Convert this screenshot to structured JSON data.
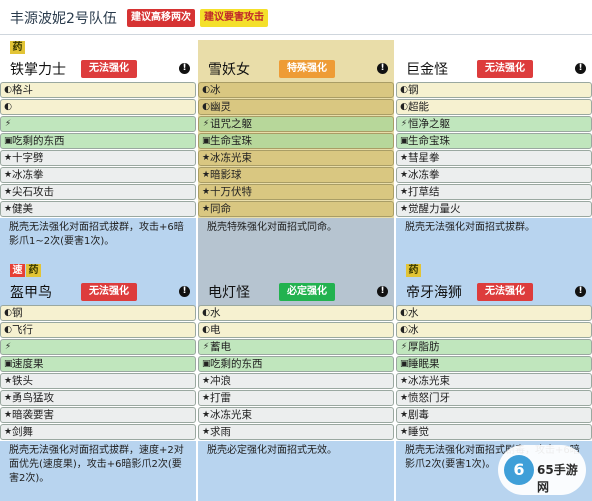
{
  "header": {
    "title": "丰源波妮2号队伍",
    "tag_red": "建议高移两次",
    "tag_yellow": "建议要害攻击"
  },
  "cards": [
    {
      "badges": [
        "药"
      ],
      "name": "铁掌力士",
      "status": "无法强化",
      "ability": "格斗",
      "ability2": "",
      "item": "",
      "held": "吃剩的东西",
      "moves": [
        "十字劈",
        "冰冻拳",
        "尖石攻击",
        "健美"
      ],
      "desc": "脱壳无法强化对面招式拔群，攻击+6暗影爪1~2次(要害1次)。"
    },
    {
      "badges": [],
      "name": "雪妖女",
      "status": "特殊强化",
      "ability": "冰",
      "ability2": "幽灵",
      "item": "诅咒之躯",
      "held": "生命宝珠",
      "moves": [
        "冰冻光束",
        "暗影球",
        "十万伏特",
        "同命"
      ],
      "desc": "脱壳特殊强化对面招式同命。"
    },
    {
      "badges": [],
      "name": "巨金怪",
      "status": "无法强化",
      "ability": "钢",
      "ability2": "超能",
      "item": "恒净之躯",
      "held": "生命宝珠",
      "moves": [
        "彗星拳",
        "冰冻拳",
        "打草结",
        "觉醒力量火"
      ],
      "desc": "脱壳无法强化对面招式拔群。"
    },
    {
      "badges": [
        "速",
        "药"
      ],
      "name": "盔甲鸟",
      "status": "无法强化",
      "ability": "钢",
      "ability2": "飞行",
      "item": "",
      "held": "速度果",
      "moves": [
        "铁头",
        "勇鸟猛攻",
        "暗袭要害",
        "剑舞"
      ],
      "desc": "脱壳无法强化对面招式拔群，速度+2对面优先(速度果)，攻击+6暗影爪2次(要害2次)。"
    },
    {
      "badges": [],
      "name": "电灯怪",
      "status": "必定强化",
      "ability": "水",
      "ability2": "电",
      "item": "蓄电",
      "held": "吃剩的东西",
      "moves": [
        "冲浪",
        "打雷",
        "冰冻光束",
        "求雨"
      ],
      "desc": "脱壳必定强化对面招式无效。"
    },
    {
      "badges": [
        "药"
      ],
      "name": "帝牙海狮",
      "status": "无法强化",
      "ability": "水",
      "ability2": "冰",
      "item": "厚脂肪",
      "held": "睡眠果",
      "moves": [
        "冰冻光束",
        "愤怒门牙",
        "剧毒",
        "睡觉"
      ],
      "desc": "脱壳无法强化对面招式剧毒，攻击+6暗影爪2次(要害1次)。"
    }
  ],
  "watermark": {
    "logo": "6",
    "text": "65手游网"
  }
}
